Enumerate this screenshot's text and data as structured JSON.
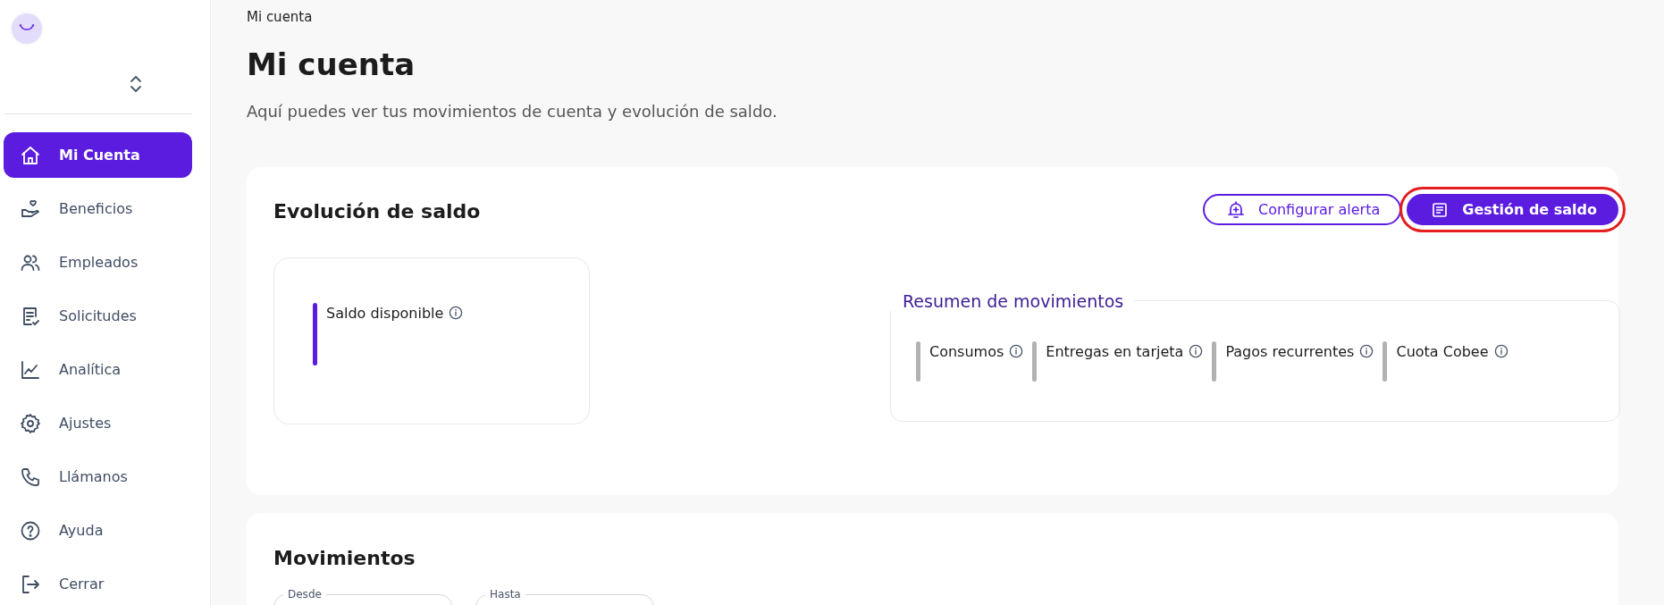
{
  "sidebar": {
    "items": [
      {
        "label": "Mi Cuenta",
        "selected": true
      },
      {
        "label": "Beneficios",
        "selected": false
      },
      {
        "label": "Empleados",
        "selected": false
      },
      {
        "label": "Solicitudes",
        "selected": false
      },
      {
        "label": "Analítica",
        "selected": false
      },
      {
        "label": "Ajustes",
        "selected": false
      },
      {
        "label": "Llámanos",
        "selected": false
      },
      {
        "label": "Ayuda",
        "selected": false
      },
      {
        "label": "Cerrar",
        "selected": false
      }
    ]
  },
  "breadcrumb": "Mi cuenta",
  "title": "Mi cuenta",
  "subtitle": "Aquí puedes ver tus movimientos de cuenta y evolución de saldo.",
  "balance_card": {
    "title": "Evolución de saldo",
    "buttons": [
      {
        "label": "Configurar alerta",
        "kind": "outline",
        "highlighted": false
      },
      {
        "label": "Gestión de saldo",
        "kind": "filled",
        "highlighted": true
      }
    ],
    "available": {
      "label": "Saldo disponible"
    },
    "summary": {
      "title": "Resumen de movimientos",
      "items": [
        {
          "label": "Consumos"
        },
        {
          "label": "Entregas en tarjeta"
        },
        {
          "label": "Pagos recurrentes"
        },
        {
          "label": "Cuota Cobee"
        }
      ]
    }
  },
  "movements": {
    "title": "Movimientos",
    "fields": [
      {
        "label": "Desde"
      },
      {
        "label": "Hasta"
      }
    ]
  }
}
